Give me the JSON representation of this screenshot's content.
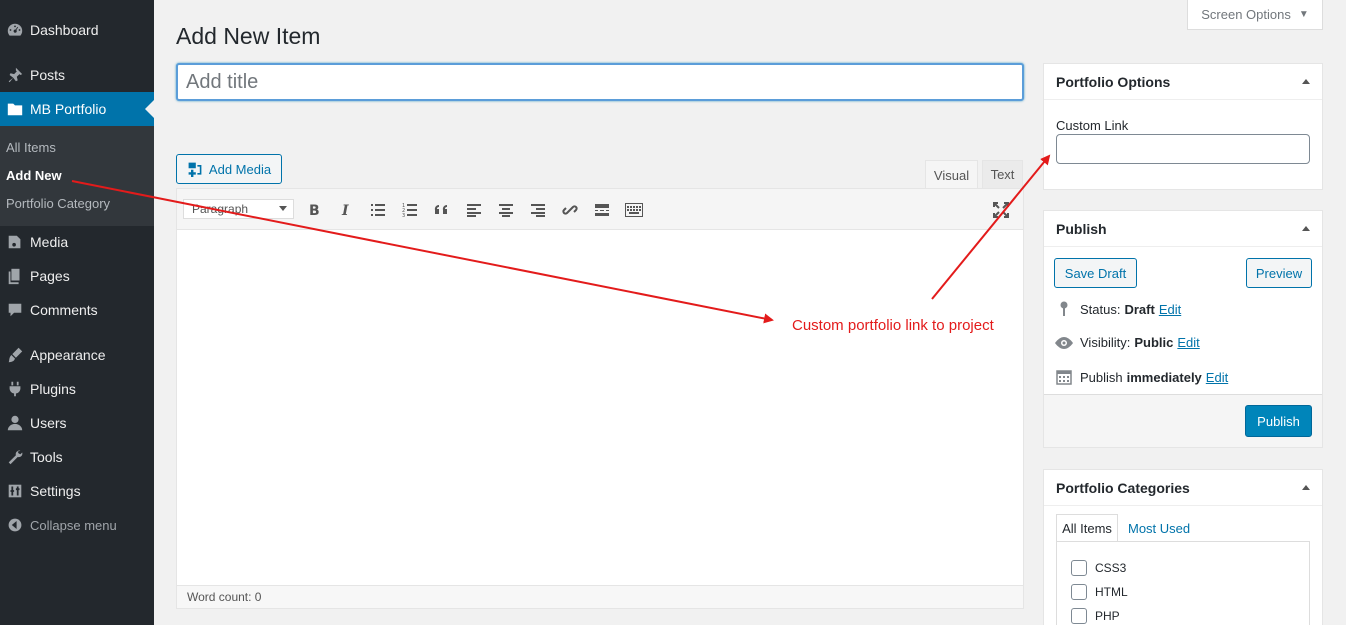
{
  "sidebar": {
    "items": {
      "dashboard": "Dashboard",
      "posts": "Posts",
      "mb_portfolio": "MB Portfolio",
      "media": "Media",
      "pages": "Pages",
      "comments": "Comments",
      "appearance": "Appearance",
      "plugins": "Plugins",
      "users": "Users",
      "tools": "Tools",
      "settings": "Settings",
      "collapse": "Collapse menu"
    },
    "submenu": {
      "all_items": "All Items",
      "add_new": "Add New",
      "portfolio_category": "Portfolio Category"
    },
    "colors": {
      "background": "#23282d",
      "active": "#0073aa",
      "submenu": "#32373c"
    }
  },
  "header": {
    "page_title": "Add New Item",
    "screen_options": "Screen Options"
  },
  "editor": {
    "title_placeholder": "Add title",
    "add_media": "Add Media",
    "tab_visual": "Visual",
    "tab_text": "Text",
    "format_select": "Paragraph",
    "toolbar_icons": [
      "bold-icon",
      "italic-icon",
      "bulleted-list-icon",
      "numbered-list-icon",
      "blockquote-icon",
      "align-left-icon",
      "align-center-icon",
      "align-right-icon",
      "link-icon",
      "read-more-icon",
      "toolbar-toggle-icon",
      "fullscreen-icon"
    ],
    "word_count": "Word count: 0"
  },
  "portfolio_options": {
    "title": "Portfolio Options",
    "custom_link_label": "Custom Link",
    "custom_link_value": ""
  },
  "publish": {
    "title": "Publish",
    "save_draft": "Save Draft",
    "preview": "Preview",
    "status_label": "Status:",
    "status_value": "Draft",
    "visibility_label": "Visibility:",
    "visibility_value": "Public",
    "publish_label": "Publish",
    "publish_value": "immediately",
    "edit": "Edit",
    "publish_button": "Publish"
  },
  "portfolio_categories": {
    "title": "Portfolio Categories",
    "tab_all": "All Items",
    "tab_most_used": "Most Used",
    "items": [
      "CSS3",
      "HTML",
      "PHP"
    ]
  },
  "annotation": {
    "text": "Custom portfolio link to project",
    "color": "#e31b1b"
  }
}
